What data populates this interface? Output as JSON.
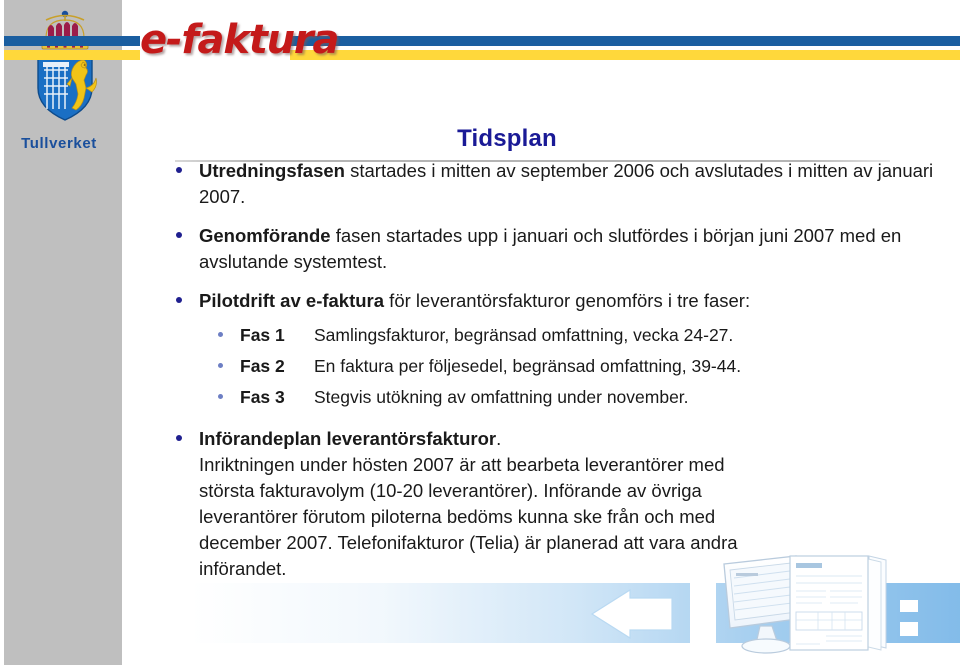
{
  "brand": {
    "wordmark": "e-faktura",
    "organization": "Tullverket",
    "logo_icon": "swedish-coat-of-arms",
    "stripe_blue": "#1a5ea0",
    "stripe_yellow": "#ffd83b",
    "brand_red": "#c41a1a",
    "org_blue": "#1a4f9c"
  },
  "slide": {
    "title": "Tidsplan",
    "title_color": "#1a1a96",
    "bullets": [
      {
        "lead": "Utredningsfasen",
        "text": " startades i mitten av september 2006 och avslutades i mitten av januari 2007."
      },
      {
        "lead": "Genomförande",
        "text": " fasen startades upp i januari och slutfördes i början juni 2007 med en avslutande systemtest."
      },
      {
        "lead": "Pilotdrift av e-faktura",
        "text": " för leverantörsfakturor genomförs i tre faser:"
      }
    ],
    "phases": [
      {
        "label": "Fas 1",
        "text": "Samlingsfakturor, begränsad omfattning, vecka 24-27."
      },
      {
        "label": "Fas 2",
        "text": "En faktura per följesedel, begränsad omfattning, 39-44."
      },
      {
        "label": "Fas 3",
        "text": "Stegvis utökning av omfattning under november."
      }
    ],
    "plan": {
      "lead": "Införandeplan leverantörsfakturor",
      "lead_suffix": ".",
      "lines": [
        "Inriktningen under hösten 2007 är att bearbeta leverantörer med",
        "största fakturavolym (10-20 leverantörer).  Införande av övriga",
        "leverantörer förutom piloterna bedöms kunna ske från och med",
        "december 2007. Telefonifakturor (Telia) är planerad att vara andra",
        "införandet."
      ]
    }
  },
  "decoration": {
    "band_color": "#7cb8e8",
    "arrow_icon": "left-arrow-icon",
    "monitor_icon": "computer-monitor-icon",
    "document_icon": "invoice-document-icon"
  }
}
